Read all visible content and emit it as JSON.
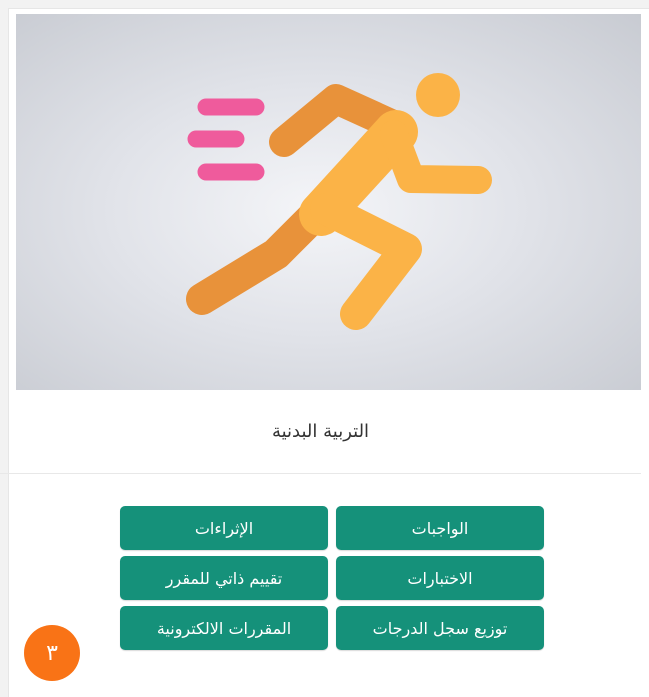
{
  "course": {
    "title": "التربية البدنية",
    "image_icon": "running-person-icon"
  },
  "actions": [
    {
      "label": "الواجبات"
    },
    {
      "label": "الإثراءات"
    },
    {
      "label": "الاختبارات"
    },
    {
      "label": "تقييم ذاتي للمقرر"
    },
    {
      "label": "توزيع سجل الدرجات"
    },
    {
      "label": "المقررات الالكترونية"
    }
  ],
  "badge": {
    "value": "٣"
  },
  "colors": {
    "button": "#15917a",
    "badge": "#f97316",
    "runner_light": "#fbb347",
    "runner_dark": "#e8923a",
    "speed_lines": "#ef5b9c"
  }
}
